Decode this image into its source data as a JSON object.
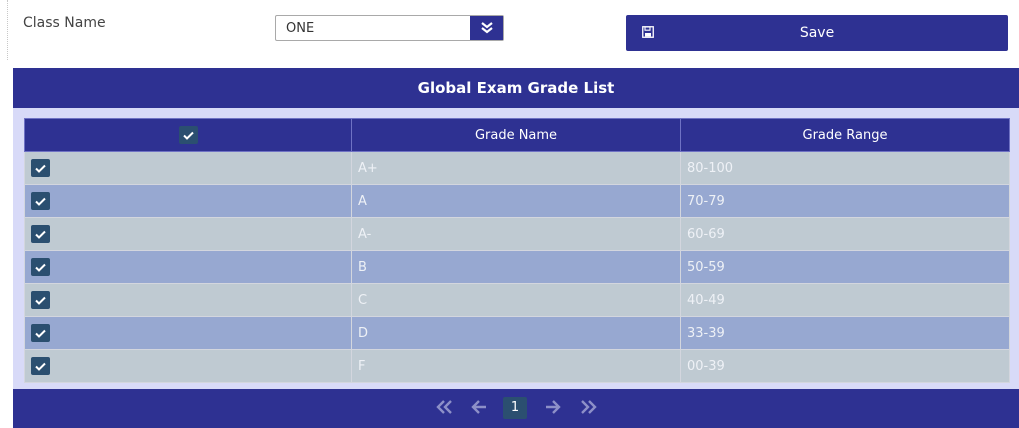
{
  "form": {
    "class_label": "Class Name",
    "class_value": "ONE",
    "save_label": "Save"
  },
  "grid": {
    "title": "Global Exam Grade List",
    "columns": [
      "",
      "Grade Name",
      "Grade Range"
    ],
    "header_checked": true,
    "rows": [
      {
        "checked": true,
        "grade": "A+",
        "range": "80-100"
      },
      {
        "checked": true,
        "grade": "A",
        "range": "70-79"
      },
      {
        "checked": true,
        "grade": "A-",
        "range": "60-69"
      },
      {
        "checked": true,
        "grade": "B",
        "range": "50-59"
      },
      {
        "checked": true,
        "grade": "C",
        "range": "40-49"
      },
      {
        "checked": true,
        "grade": "D",
        "range": "33-39"
      },
      {
        "checked": true,
        "grade": "F",
        "range": "00-39"
      }
    ]
  },
  "pager": {
    "current_page": "1",
    "icons": [
      "first-page-icon",
      "prev-page-icon",
      "next-page-icon",
      "last-page-icon"
    ]
  },
  "colors": {
    "primary": "#2e3192",
    "panel": "#d8daf8",
    "row_odd": "#bfcad2",
    "row_even": "#97a8d1",
    "checkbox": "#2b4f70"
  }
}
